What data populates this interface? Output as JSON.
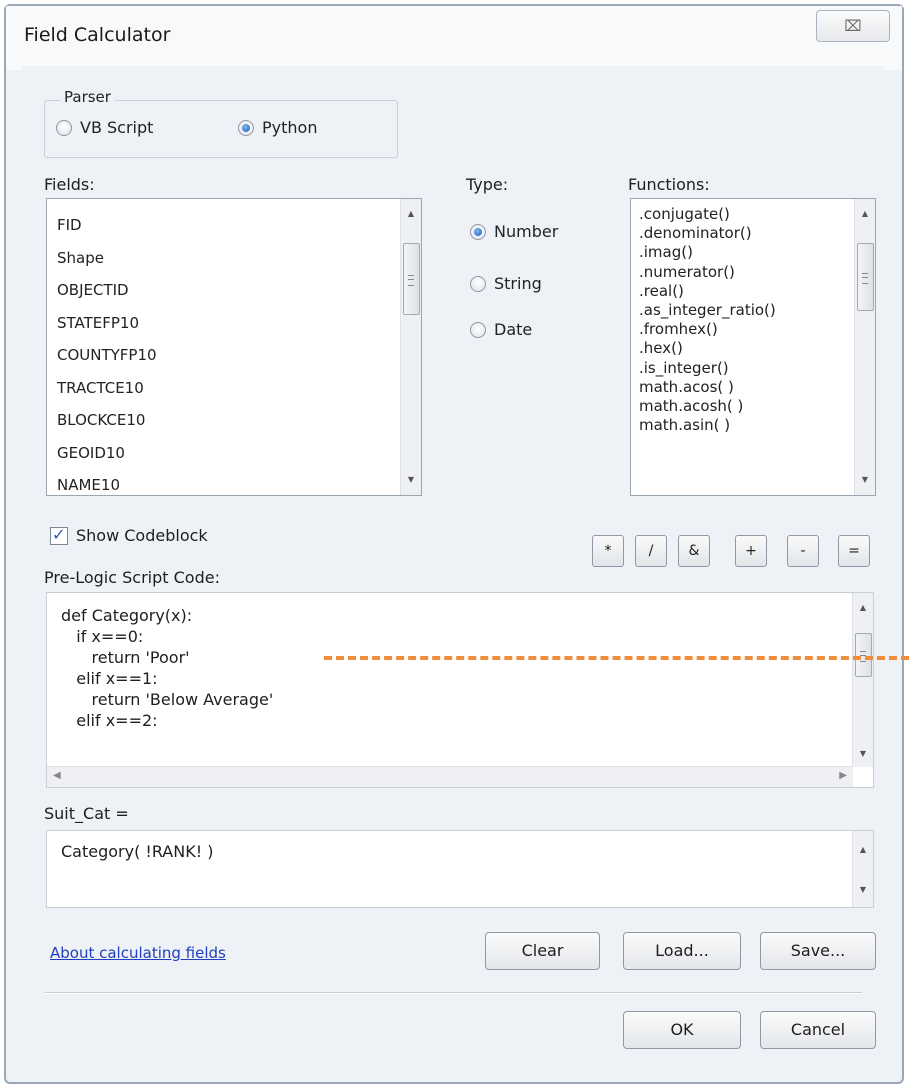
{
  "window": {
    "title": "Field Calculator",
    "close_glyph": "⌧",
    "accent_color": "#1e5fbf",
    "annotation_color": "#ef8d3c"
  },
  "parser": {
    "label": "Parser",
    "options": [
      {
        "label": "VB Script",
        "selected": false
      },
      {
        "label": "Python",
        "selected": true
      }
    ]
  },
  "fields": {
    "label": "Fields:",
    "items": [
      "FID",
      "Shape",
      "OBJECTID",
      "STATEFP10",
      "COUNTYFP10",
      "TRACTCE10",
      "BLOCKCE10",
      "GEOID10",
      "NAME10"
    ]
  },
  "type": {
    "label": "Type:",
    "options": [
      {
        "label": "Number",
        "selected": true
      },
      {
        "label": "String",
        "selected": false
      },
      {
        "label": "Date",
        "selected": false
      }
    ]
  },
  "functions": {
    "label": "Functions:",
    "items": [
      ".conjugate()",
      ".denominator()",
      ".imag()",
      ".numerator()",
      ".real()",
      ".as_integer_ratio()",
      ".fromhex()",
      ".hex()",
      ".is_integer()",
      "math.acos( )",
      "math.acosh( )",
      "math.asin( )"
    ]
  },
  "operators": [
    "*",
    "/",
    "&",
    "+",
    "-",
    "="
  ],
  "show_codeblock": {
    "label": "Show Codeblock",
    "checked": true
  },
  "prelogic": {
    "label": "Pre-Logic Script Code:",
    "code": "def Category(x):\n   if x==0:\n      return 'Poor'\n   elif x==1:\n      return 'Below Average'\n   elif x==2:"
  },
  "expression": {
    "label": "Suit_Cat =",
    "value": "Category( !RANK! )"
  },
  "links": {
    "about": "About calculating fields"
  },
  "buttons": {
    "clear": "Clear",
    "load": "Load...",
    "save": "Save...",
    "ok": "OK",
    "cancel": "Cancel"
  },
  "icons": {
    "scroll_up": "▲",
    "scroll_down": "▼",
    "scroll_left": "◀",
    "scroll_right": "▶",
    "check": "✓"
  }
}
